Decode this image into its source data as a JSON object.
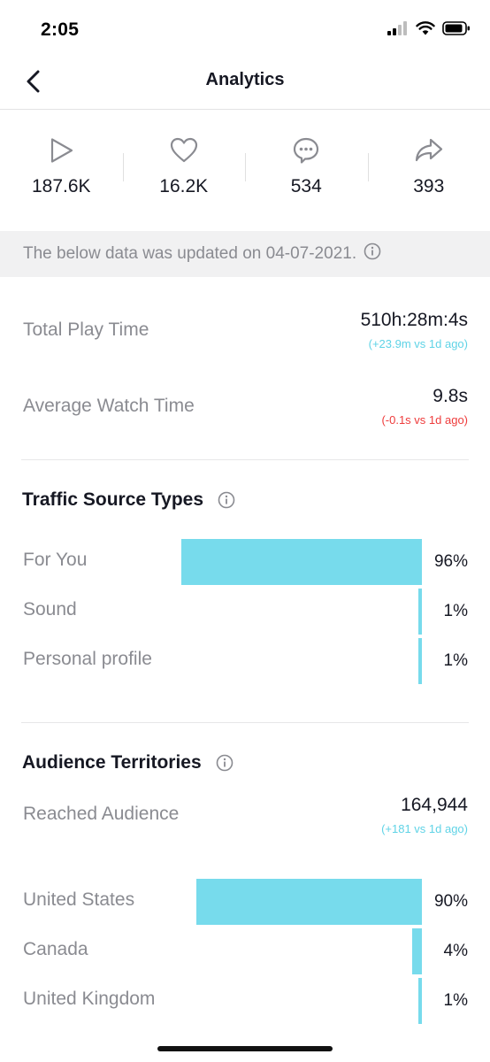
{
  "status_bar": {
    "time": "2:05"
  },
  "nav": {
    "title": "Analytics"
  },
  "stats": [
    {
      "icon": "play-icon",
      "value": "187.6K"
    },
    {
      "icon": "heart-icon",
      "value": "16.2K"
    },
    {
      "icon": "comment-icon",
      "value": "534"
    },
    {
      "icon": "share-icon",
      "value": "393"
    }
  ],
  "banner": {
    "text": "The below data was updated on 04-07-2021."
  },
  "metrics": {
    "total_play_time": {
      "label": "Total Play Time",
      "value": "510h:28m:4s",
      "delta": "(+23.9m vs 1d ago)"
    },
    "average_watch_time": {
      "label": "Average Watch Time",
      "value": "9.8s",
      "delta": "(-0.1s vs 1d ago)"
    }
  },
  "traffic": {
    "title": "Traffic Source Types",
    "rows": [
      {
        "label": "For You",
        "percent": 96,
        "pct_text": "96%"
      },
      {
        "label": "Sound",
        "percent": 1,
        "pct_text": "1%"
      },
      {
        "label": "Personal profile",
        "percent": 1,
        "pct_text": "1%"
      }
    ]
  },
  "audience": {
    "title": "Audience Territories",
    "reached_label": "Reached Audience",
    "reached_value": "164,944",
    "reached_delta": "(+181 vs 1d ago)",
    "rows": [
      {
        "label": "United States",
        "percent": 90,
        "pct_text": "90%"
      },
      {
        "label": "Canada",
        "percent": 4,
        "pct_text": "4%"
      },
      {
        "label": "United Kingdom",
        "percent": 1,
        "pct_text": "1%"
      }
    ]
  },
  "colors": {
    "bar": "#77dbec",
    "delta_up": "#5fd3e6",
    "delta_down": "#ee3b3b",
    "banner_bg": "#f1f1f2"
  }
}
